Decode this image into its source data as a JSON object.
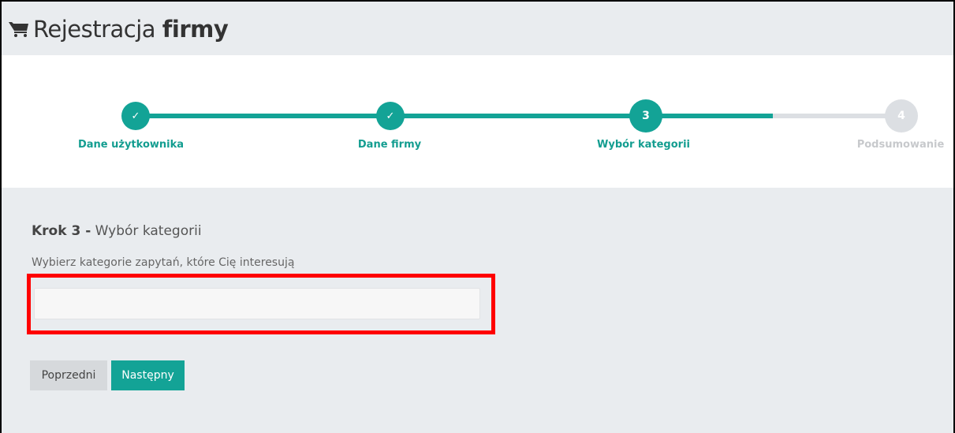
{
  "header": {
    "icon": "cart-icon",
    "title_prefix": "Rejestracja",
    "title_bold": "firmy"
  },
  "wizard": {
    "steps": [
      {
        "label": "Dane użytkownika",
        "marker": "✓",
        "status": "done"
      },
      {
        "label": "Dane firmy",
        "marker": "✓",
        "status": "done"
      },
      {
        "label": "Wybór kategorii",
        "marker": "3",
        "status": "current"
      },
      {
        "label": "Podsumowanie",
        "marker": "4",
        "status": "pending"
      }
    ]
  },
  "main": {
    "heading_bold": "Krok 3 -",
    "heading_rest": " Wybór kategorii",
    "instruction": "Wybierz kategorie zapytań, które Cię interesują",
    "category_input_value": "",
    "prev_button": "Poprzedni",
    "next_button": "Następny"
  },
  "colors": {
    "accent": "#13a396",
    "pending": "#dcdfe3",
    "highlight": "#ff0000",
    "background": "#e9ecef"
  }
}
